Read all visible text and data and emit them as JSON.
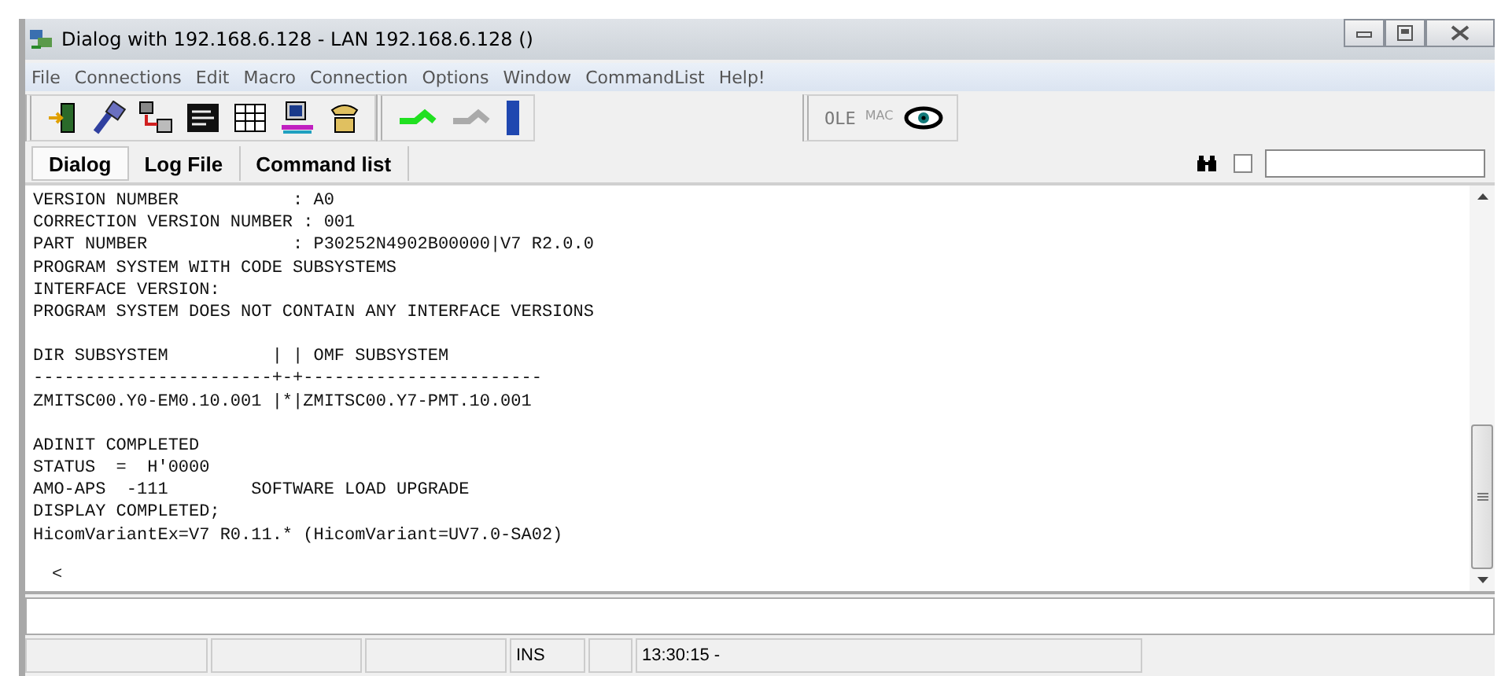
{
  "window": {
    "title": "Dialog with 192.168.6.128 - LAN 192.168.6.128 ()"
  },
  "menu": [
    "File",
    "Connections",
    "Edit",
    "Macro",
    "Connection",
    "Options",
    "Window",
    "CommandList",
    "Help!"
  ],
  "toolbar": {
    "ole_label": "OLE",
    "mac_label": "MAC"
  },
  "tabs": [
    {
      "label": "Dialog",
      "selected": true
    },
    {
      "label": "Log File",
      "selected": false
    },
    {
      "label": "Command list",
      "selected": false
    }
  ],
  "search": {
    "checked": false
  },
  "output": {
    "blocks": [
      {
        "lines": [
          "VERSION NUMBER           : A0",
          "CORRECTION VERSION NUMBER : 001",
          "PART NUMBER              : P30252N4902B00000|V7 R2.0.0",
          "PROGRAM SYSTEM WITH CODE SUBSYSTEMS",
          "INTERFACE VERSION:",
          "PROGRAM SYSTEM DOES NOT CONTAIN ANY INTERFACE VERSIONS"
        ]
      },
      {
        "lines": [
          "DIR SUBSYSTEM          | | OMF SUBSYSTEM",
          "-----------------------+-+-----------------------",
          "ZMITSC00.Y0-EM0.10.001 |*|ZMITSC00.Y7-PMT.10.001"
        ]
      },
      {
        "lines": [
          "ADINIT COMPLETED",
          "STATUS  =  H'0000",
          "AMO-APS  -111        SOFTWARE LOAD UPGRADE",
          "DISPLAY COMPLETED;",
          "HicomVariantEx=V7 R0.11.* (HicomVariant=UV7.0-SA02)"
        ]
      }
    ],
    "prompt": "<"
  },
  "status_bar": [
    "INS",
    "13:30:15 -"
  ]
}
